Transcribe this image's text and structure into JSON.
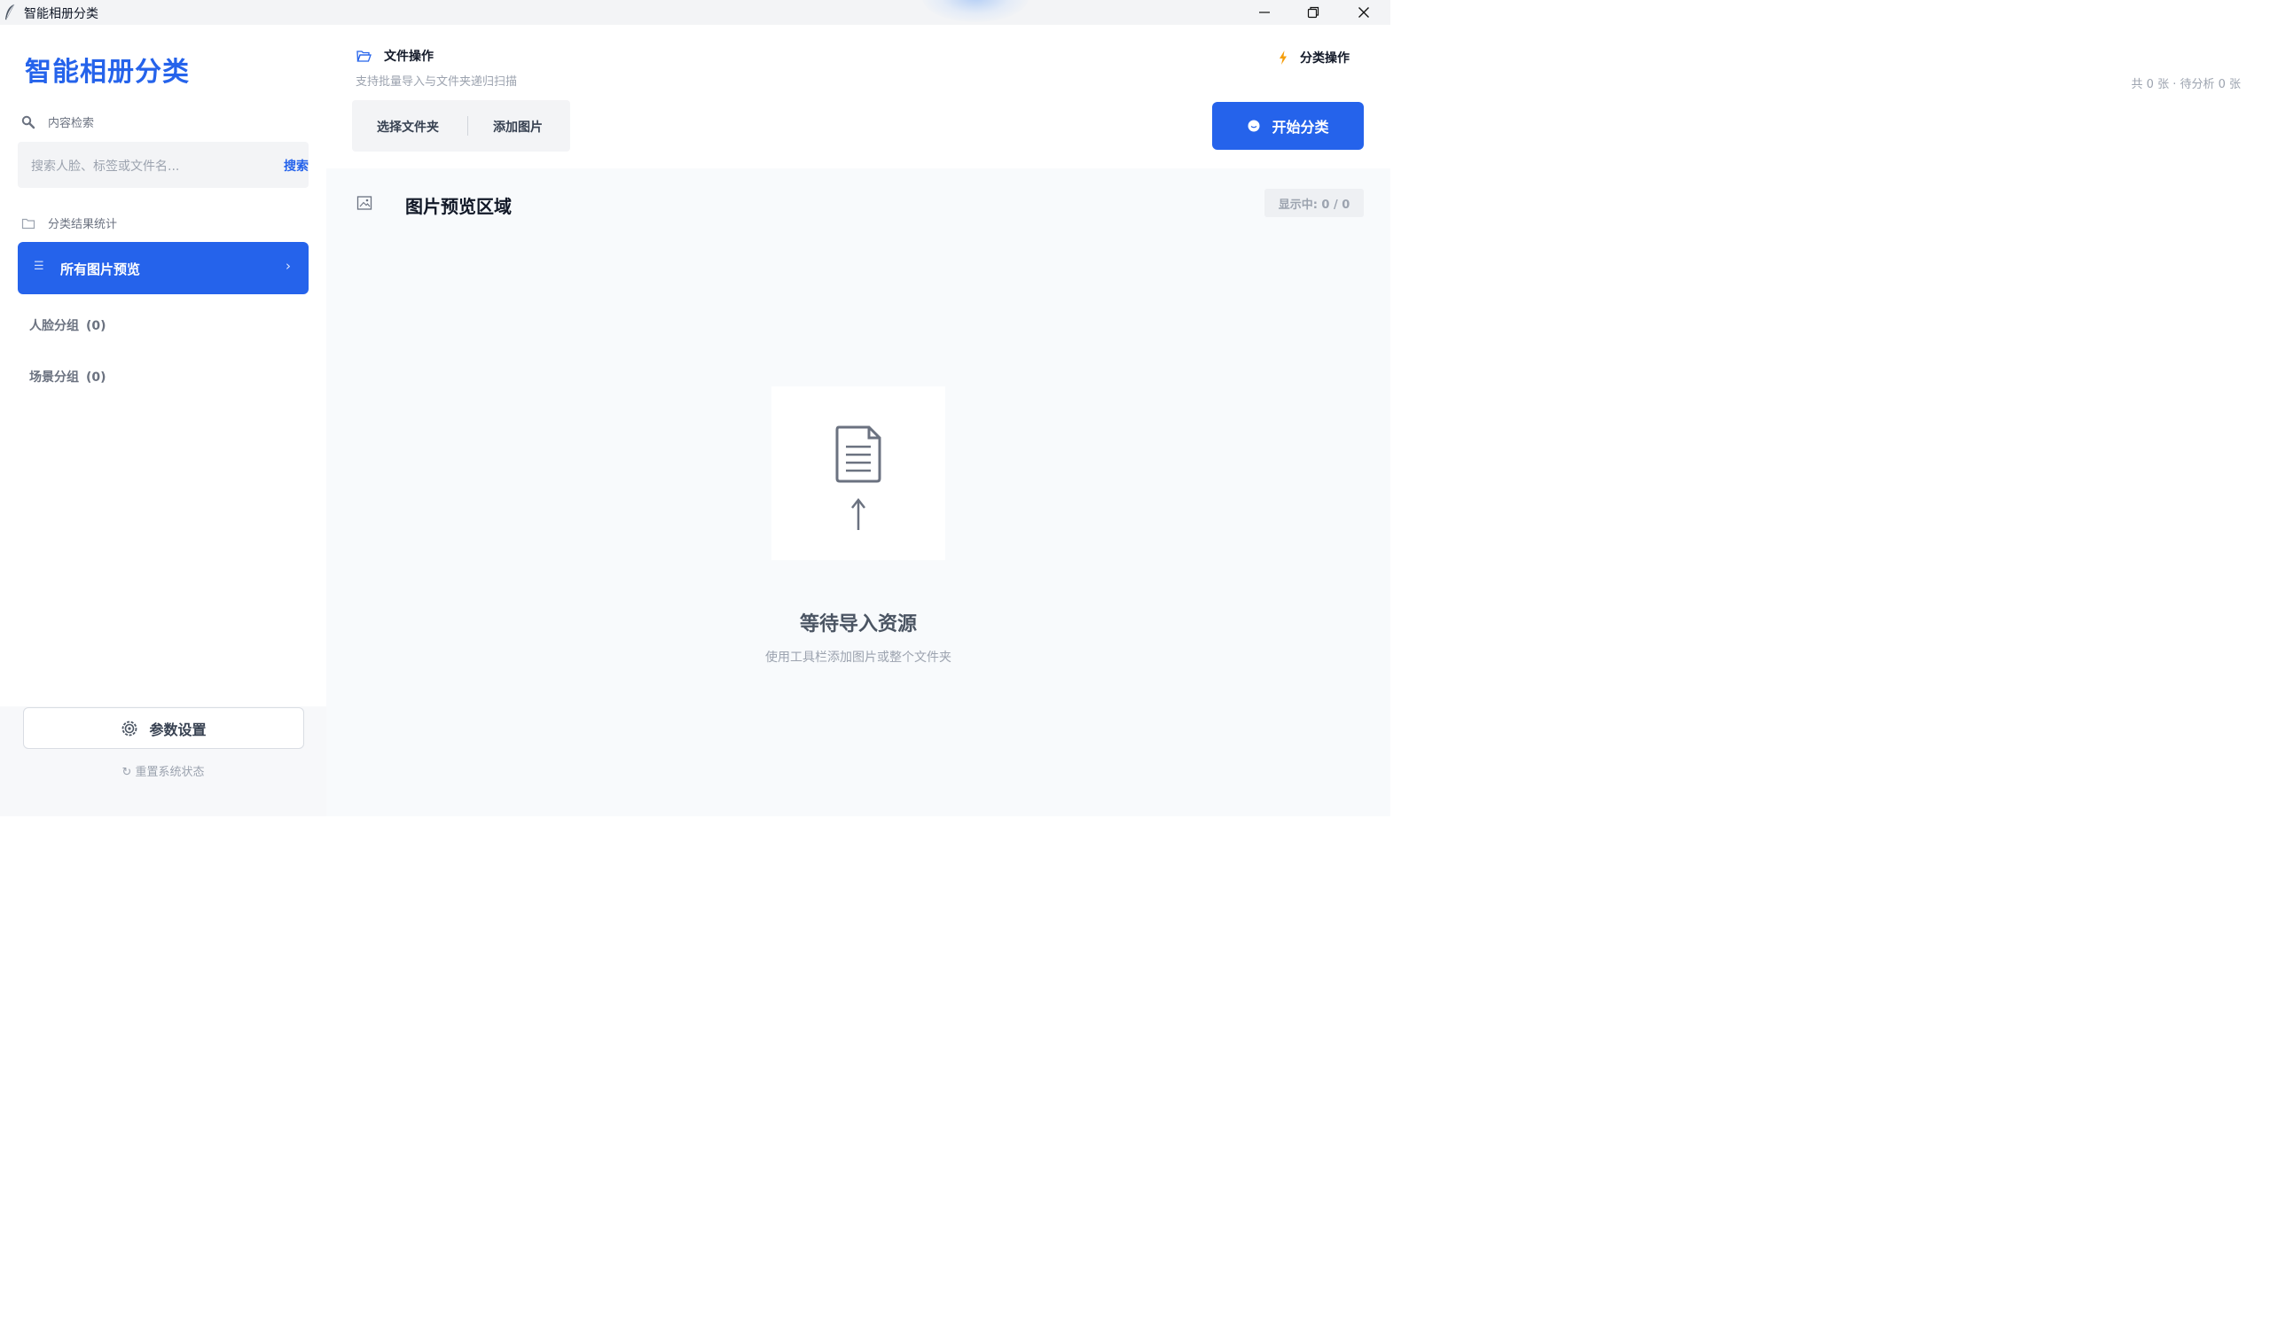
{
  "window": {
    "title": "智能相册分类"
  },
  "sidebar": {
    "brand": "智能相册分类",
    "search_section_label": "内容检索",
    "search": {
      "placeholder": "搜索人脸、标签或文件名...",
      "button_label": "搜索"
    },
    "stats_section_label": "分类结果统计",
    "nav_active": {
      "label": "所有图片预览",
      "chevron": "›",
      "icon": "menu-lines-icon"
    },
    "nav_items": [
      {
        "label": "人脸分组",
        "count": "(0)"
      },
      {
        "label": "场景分组",
        "count": "(0)"
      }
    ],
    "settings_label": "参数设置",
    "reset_label": "重置系统状态"
  },
  "toolbar": {
    "file_ops_title": "文件操作",
    "file_ops_subtitle": "支持批量导入与文件夹递归扫描",
    "select_folder_label": "选择文件夹",
    "add_images_label": "添加图片",
    "classify_title": "分类操作",
    "classify_stats": "共 0 张 · 待分析 0 张",
    "start_button_label": "开始分类"
  },
  "preview": {
    "title": "图片预览区域",
    "showing_badge": "显示中: 0 / 0",
    "empty_title": "等待导入资源",
    "empty_subtitle": "使用工具栏添加图片或整个文件夹"
  },
  "colors": {
    "accent": "#2563eb",
    "lightning": "#f59e0b"
  }
}
